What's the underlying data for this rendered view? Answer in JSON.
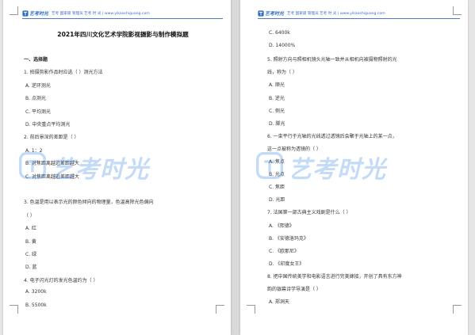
{
  "header": {
    "logo_text": "艺考时光",
    "info_text": "艺考 国家级 管理员 艺考 时 光 | www.yikaoshiguang.com"
  },
  "left_page": {
    "title": "2021年四川文化艺术学院影视摄影与制作模拟题",
    "lines": [
      {
        "text": "一、选择题",
        "kind": "section"
      },
      {
        "text": "1. 拍摄剪影作品时应选（    ）测光方法",
        "kind": "q"
      },
      {
        "text": "A. 逆环测光",
        "kind": "o"
      },
      {
        "text": "B. 点测光",
        "kind": "o"
      },
      {
        "text": "C. 平均测光",
        "kind": "o"
      },
      {
        "text": "D. 中央重点平均测光",
        "kind": "o"
      },
      {
        "text": "2. 前后景深的差距是（    ）",
        "kind": "q"
      },
      {
        "text": "A. 1：2",
        "kind": "o"
      },
      {
        "text": "B. 对焦距离越远差距越大",
        "kind": "o"
      },
      {
        "text": "C. 对焦距离越近差距越大",
        "kind": "o"
      },
      {
        "text": "",
        "kind": "o"
      },
      {
        "text": "3. 色温是用以表示光的颜色倾向的物理量，色温高除光色偏向",
        "kind": "q"
      },
      {
        "text": "（    ）",
        "kind": "q"
      },
      {
        "text": "A. 红",
        "kind": "o"
      },
      {
        "text": "B. 黄",
        "kind": "o"
      },
      {
        "text": "C. 绿",
        "kind": "o"
      },
      {
        "text": "D. 蓝",
        "kind": "o"
      },
      {
        "text": "4. 电子闪光灯的发光色温约为（    ）",
        "kind": "q"
      },
      {
        "text": "A. 3200k",
        "kind": "o"
      },
      {
        "text": "B. 5500k",
        "kind": "o"
      }
    ]
  },
  "right_page": {
    "lines": [
      {
        "text": "C. 6400k",
        "kind": "o"
      },
      {
        "text": "D. 14000%",
        "kind": "o"
      },
      {
        "text": "5. 照射方向与照相机镜头光轴一致并从相机向被摄物照射的光",
        "kind": "q"
      },
      {
        "text": "线，称为（    ）",
        "kind": "q"
      },
      {
        "text": "A. 顺光",
        "kind": "o"
      },
      {
        "text": "B. 逆光",
        "kind": "o"
      },
      {
        "text": "C. 侧光",
        "kind": "o"
      },
      {
        "text": "D. 脚光",
        "kind": "o"
      },
      {
        "text": "6. 一束平行于光轴的光线透过透镜后会聚于光轴上的某一点，",
        "kind": "q"
      },
      {
        "text": "这一点被称为透镜的（    ）",
        "kind": "q"
      },
      {
        "text": "A. 焦点",
        "kind": "o"
      },
      {
        "text": "B. 光点",
        "kind": "o"
      },
      {
        "text": "C. 焦距",
        "kind": "o"
      },
      {
        "text": "D. 光距",
        "kind": "o"
      },
      {
        "text": "7. 法国第一部古典主义戏剧是什么（    ）",
        "kind": "q"
      },
      {
        "text": "A. 《熙德》",
        "kind": "o"
      },
      {
        "text": "B. 《安德洛玛克》",
        "kind": "o"
      },
      {
        "text": "C. 《欧那尼》",
        "kind": "o"
      },
      {
        "text": "D. 《印度女王》",
        "kind": "o"
      },
      {
        "text": "8. 把中国传统美学和电影语言进行完美嫁接，开创了具有东方神",
        "kind": "q"
      },
      {
        "text": "韵的银幕诗学导演是（    ）",
        "kind": "q"
      },
      {
        "text": "A. 郑洞天",
        "kind": "o"
      }
    ]
  },
  "watermark": {
    "text": "艺考时光"
  },
  "colors": {
    "accent": "#2f6fbf",
    "watermark": "#2a7fe0",
    "background": "#e6e6e6"
  }
}
